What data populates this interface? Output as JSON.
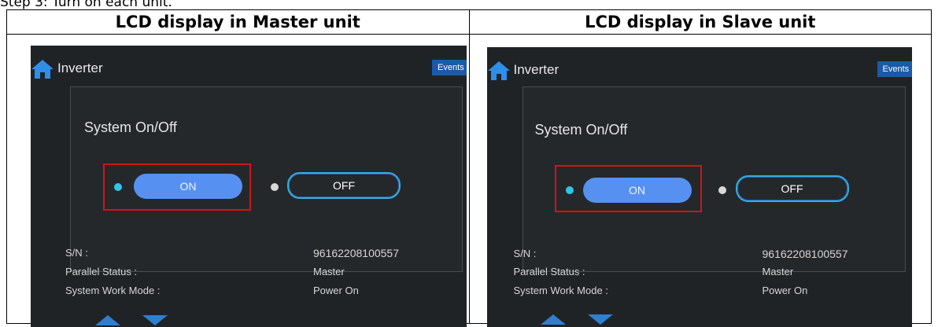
{
  "step_text": "Step 3: Turn on each unit.",
  "columns": [
    {
      "header": "LCD display in Master unit",
      "screen": {
        "title": "Inverter",
        "events_label": "Events",
        "system_label": "System On/Off",
        "on_label": "ON",
        "off_label": "OFF",
        "rows": [
          {
            "label": "S/N :",
            "value": "96162208100557"
          },
          {
            "label": "Parallel Status :",
            "value": "Master"
          },
          {
            "label": "System Work Mode :",
            "value": "Power On"
          }
        ]
      }
    },
    {
      "header": "LCD display in Slave unit",
      "screen": {
        "title": "Inverter",
        "events_label": "Events",
        "system_label": "System On/Off",
        "on_label": "ON",
        "off_label": "OFF",
        "rows": [
          {
            "label": "S/N :",
            "value": "96162208100557"
          },
          {
            "label": "Parallel Status :",
            "value": "Master"
          },
          {
            "label": "System Work Mode :",
            "value": "Power On"
          }
        ]
      }
    }
  ],
  "colors": {
    "screen_bg": "#202326",
    "on_button": "#5691f2",
    "off_border": "#34aee0",
    "highlight": "#d21414",
    "arrows": "#2f7fd0",
    "home_icon": "#2f8ee8"
  },
  "icons": [
    "home-icon",
    "up-arrow-icon",
    "down-arrow-icon"
  ]
}
